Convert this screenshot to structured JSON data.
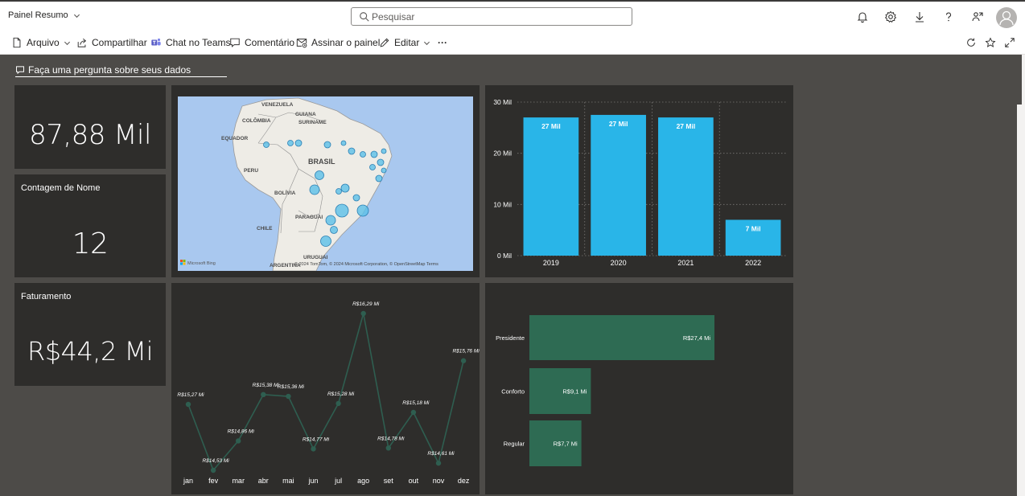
{
  "header": {
    "app_title": "Painel Resumo",
    "search_placeholder": "Pesquisar"
  },
  "toolbar": {
    "file": "Arquivo",
    "share": "Compartilhar",
    "teams": "Chat no Teams",
    "comment": "Comentário",
    "subscribe": "Assinar o painel",
    "edit": "Editar",
    "more": "···"
  },
  "qna": {
    "label": "Faça uma pergunta sobre seus dados"
  },
  "cards": {
    "total": {
      "value": "87,88 Mil"
    },
    "count": {
      "title": "Contagem de Nome",
      "value": "12"
    },
    "revenue": {
      "title": "Faturamento",
      "value": "R$44,2 Mi"
    }
  },
  "map": {
    "labels": [
      "VENEZUELA",
      "GUIANA",
      "SURINAME",
      "COLÔMBIA",
      "EQUADOR",
      "BRASIL",
      "PERU",
      "BOLÍVIA",
      "PARAGUAI",
      "CHILE",
      "URUGUAI",
      "ARGENTINA"
    ],
    "attribution": "© 2024 TomTom, © 2024 Microsoft Corporation, © OpenStreetMap  Terms",
    "logo": "Microsoft Bing"
  },
  "colors": {
    "bar": "#29b5e8",
    "line": "#2e5e50",
    "hbar": "#2e6b53",
    "tile": "#2e2d2b",
    "canvas": "#4d4b48"
  },
  "chart_data": [
    {
      "type": "bar",
      "categories": [
        "2019",
        "2020",
        "2021",
        "2022"
      ],
      "values": [
        27,
        27.5,
        27,
        7
      ],
      "data_labels": [
        "27 Mil",
        "27 Mil",
        "27 Mil",
        "7 Mil"
      ],
      "y_ticks": [
        "0 Mil",
        "10 Mil",
        "20 Mil",
        "30 Mil"
      ],
      "ylim": [
        0,
        30
      ],
      "grid": true
    },
    {
      "type": "line",
      "categories": [
        "jan",
        "fev",
        "mar",
        "abr",
        "mai",
        "jun",
        "jul",
        "ago",
        "set",
        "out",
        "nov",
        "dez"
      ],
      "values": [
        15.27,
        14.53,
        14.86,
        15.38,
        15.36,
        14.77,
        15.28,
        16.29,
        14.78,
        15.18,
        14.61,
        15.76
      ],
      "data_labels": [
        "R$15,27 Mi",
        "R$14,53 Mi",
        "R$14,86 Mi",
        "R$15,38 Mi",
        "R$15,36 Mi",
        "R$14,77 Mi",
        "R$15,28 Mi",
        "R$16,29 Mi",
        "R$14,78 Mi",
        "R$15,18 Mi",
        "R$14,61 Mi",
        "R$15,76 Mi"
      ]
    },
    {
      "type": "bar",
      "orientation": "horizontal",
      "categories": [
        "Presidente",
        "Conforto",
        "Regular"
      ],
      "values": [
        27.4,
        9.1,
        7.7
      ],
      "data_labels": [
        "R$27,4 Mi",
        "R$9,1 Mi",
        "R$7,7 Mi"
      ]
    }
  ]
}
